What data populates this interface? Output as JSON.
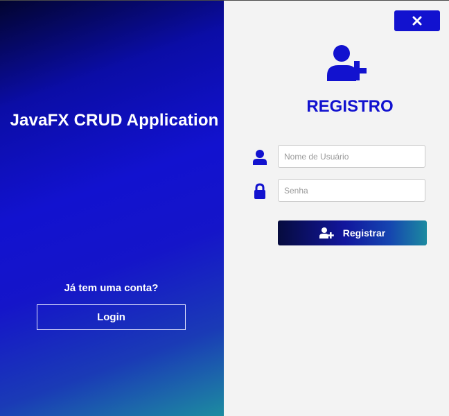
{
  "left": {
    "app_title": "JavaFX CRUD Application",
    "have_account_text": "Já tem uma conta?",
    "login_label": "Login"
  },
  "right": {
    "close_icon": "close-icon",
    "hero_icon": "user-plus-icon",
    "title": "REGISTRO",
    "username": {
      "icon": "user-icon",
      "placeholder": "Nome de Usuário",
      "value": ""
    },
    "password": {
      "icon": "lock-icon",
      "placeholder": "Senha",
      "value": ""
    },
    "register_icon": "user-plus-icon",
    "register_label": "Registrar"
  },
  "colors": {
    "accent": "#1212cf",
    "gradient_start": "#02042e",
    "gradient_end": "#1d8ca0",
    "background": "#f3f3f3"
  }
}
